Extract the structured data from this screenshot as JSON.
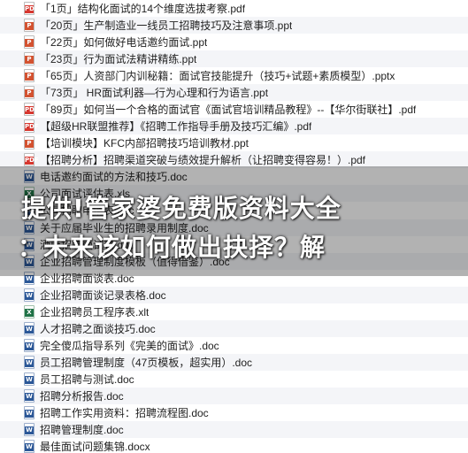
{
  "files": [
    {
      "name": "「1页」结构化面试的14个维度选拔考察.pdf",
      "type": "pdf",
      "icon": "pdf-file-icon"
    },
    {
      "name": "「20页」生产制造业一线员工招聘技巧及注意事项.ppt",
      "type": "ppt",
      "icon": "ppt-file-icon"
    },
    {
      "name": "「22页」如何做好电话邀约面试.ppt",
      "type": "ppt",
      "icon": "ppt-file-icon"
    },
    {
      "name": "「23页」行为面试法精讲精练.ppt",
      "type": "ppt",
      "icon": "ppt-file-icon"
    },
    {
      "name": "「65页」人资部门内训秘籍：面试官技能提升（技巧+试题+素质模型）.pptx",
      "type": "ppt",
      "icon": "ppt-file-icon"
    },
    {
      "name": "「73页」 HR面试利器—行为心理和行为语言.ppt",
      "type": "ppt",
      "icon": "ppt-file-icon"
    },
    {
      "name": "「89页」如何当一个合格的面试官《面试官培训精品教程》--【华尔街联社】.pdf",
      "type": "pdf",
      "icon": "pdf-file-icon"
    },
    {
      "name": "【超级HR联盟推荐】《招聘工作指导手册及技巧汇编》.pdf",
      "type": "pdf",
      "icon": "pdf-file-icon"
    },
    {
      "name": "【培训模块】KFC内部招聘技巧培训教材.ppt",
      "type": "ppt",
      "icon": "ppt-file-icon"
    },
    {
      "name": "【招聘分析】招聘渠道突破与绩效提升解析（让招聘变得容易！）.pdf",
      "type": "pdf",
      "icon": "pdf-file-icon"
    },
    {
      "name": "电话邀约面试的方法和技巧.doc",
      "type": "doc",
      "icon": "doc-file-icon"
    },
    {
      "name": "公司面试评估表.xls",
      "type": "xls",
      "icon": "xls-file-icon"
    },
    {
      "name": "公司招聘申请表.doc",
      "type": "doc",
      "icon": "doc-file-icon"
    },
    {
      "name": "关于应届毕业生的招聘录用制度.doc",
      "type": "doc",
      "icon": "doc-file-icon"
    },
    {
      "name": "酒店招聘面试表.doc",
      "type": "doc",
      "icon": "doc-file-icon"
    },
    {
      "name": "企业招聘管理制度模板（值得借鉴）.doc",
      "type": "doc",
      "icon": "doc-file-icon"
    },
    {
      "name": "企业招聘面谈表.doc",
      "type": "doc",
      "icon": "doc-file-icon"
    },
    {
      "name": "企业招聘面谈记录表格.doc",
      "type": "doc",
      "icon": "doc-file-icon"
    },
    {
      "name": "企业招聘员工程序表.xlt",
      "type": "xls",
      "icon": "xls-file-icon"
    },
    {
      "name": "人才招聘之面谈技巧.doc",
      "type": "doc",
      "icon": "doc-file-icon"
    },
    {
      "name": "完全傻瓜指导系列《完美的面试》.doc",
      "type": "doc",
      "icon": "doc-file-icon"
    },
    {
      "name": "员工招聘管理制度（47页模板，超实用）.doc",
      "type": "doc",
      "icon": "doc-file-icon"
    },
    {
      "name": "员工招聘与测试.doc",
      "type": "doc",
      "icon": "doc-file-icon"
    },
    {
      "name": "招聘分析报告.doc",
      "type": "doc",
      "icon": "doc-file-icon"
    },
    {
      "name": "招聘工作实用资料：招聘流程图.doc",
      "type": "doc",
      "icon": "doc-file-icon"
    },
    {
      "name": "招聘管理制度.doc",
      "type": "doc",
      "icon": "doc-file-icon"
    },
    {
      "name": "最佳面试问题集锦.docx",
      "type": "doc",
      "icon": "doc-file-icon"
    }
  ],
  "icon_badges": {
    "pdf": "PDF",
    "ppt": "P",
    "doc": "W",
    "xls": "X"
  },
  "watermark": {
    "line1": "提供!管家婆免费版资料大全",
    "line2": "：未来该如何做出抉择？解"
  },
  "colors": {
    "row_alt": "#f4f5f8",
    "pdf": "#d7372f",
    "ppt": "#d35230",
    "doc": "#2b5797",
    "xls": "#1f7246"
  }
}
